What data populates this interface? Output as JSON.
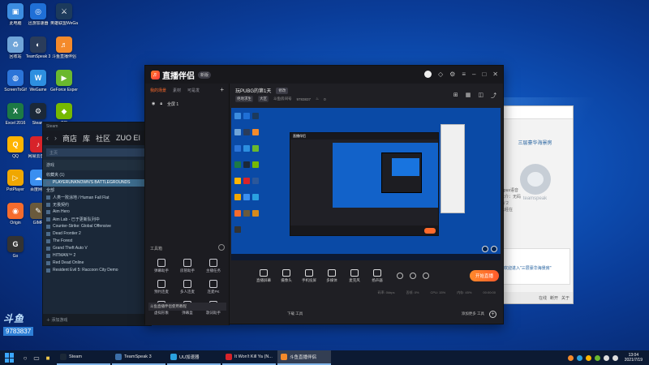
{
  "desktop": {
    "icons": [
      {
        "label": "此电脑",
        "color": "#3c8de0",
        "glyph": "▣"
      },
      {
        "label": "迅游加速器",
        "color": "#1f6fd6",
        "glyph": "◎"
      },
      {
        "label": "英雄联盟WeGame版",
        "color": "#1c3a5c",
        "glyph": "⚔"
      },
      {
        "label": "回收站",
        "color": "#6fa4d8",
        "glyph": "♻"
      },
      {
        "label": "TeamSpeak 3",
        "color": "#2a3c5a",
        "glyph": "◐"
      },
      {
        "label": "斗鱼直播伴侣",
        "color": "#f48a2b",
        "glyph": "♬"
      },
      {
        "label": "ScreenToGif",
        "color": "#2b74d8",
        "glyph": "◍"
      },
      {
        "label": "WeGame",
        "color": "#2d8fe0",
        "glyph": "W"
      },
      {
        "label": "GeForce Experience",
        "color": "#6ab82e",
        "glyph": "▶"
      },
      {
        "label": "Excel 2016",
        "color": "#1d7a45",
        "glyph": "X"
      },
      {
        "label": "Steam",
        "color": "#1b2838",
        "glyph": "⚙"
      },
      {
        "label": "GIF",
        "color": "#76b900",
        "glyph": "◆"
      },
      {
        "label": "QQ",
        "color": "#ffb400",
        "glyph": "Q"
      },
      {
        "label": "网易云音乐",
        "color": "#d8232a",
        "glyph": "♪"
      },
      {
        "label": "Word 2016",
        "color": "#2b579a",
        "glyph": "W"
      },
      {
        "label": "PotPlayer",
        "color": "#f0a700",
        "glyph": "▷"
      },
      {
        "label": "百度网盘",
        "color": "#3b8ff0",
        "glyph": "☁"
      },
      {
        "label": "UU加速器",
        "color": "#2aa1e0",
        "glyph": "U"
      },
      {
        "label": "Origin",
        "color": "#f56c2d",
        "glyph": "◉"
      },
      {
        "label": "GIMP",
        "color": "#6a5a3c",
        "glyph": "✎"
      },
      {
        "label": "Counter-Strike",
        "color": "#d68a1c",
        "glyph": "✦"
      },
      {
        "label": "Go",
        "color": "#333333",
        "glyph": "G"
      }
    ],
    "watermark": {
      "logo": "斗鱼",
      "sub": "直播号",
      "number": "9783837"
    }
  },
  "steam": {
    "title": "Steam",
    "nav": [
      "商店",
      "库",
      "社区",
      "ZUO EI"
    ],
    "search_placeholder": "主页",
    "category": "游戏",
    "fav_header": "收藏夹 (1)",
    "all_header": "全部",
    "games": [
      "PLAYERUNKNOWN'S BATTLEGROUNDS",
      "人类一败涂地 / Human Fall Flat",
      "无畏契约",
      "Aim Hero",
      "Aim Lab - 已于更新队列中",
      "Counter-Strike: Global Offensive",
      "Dead Frontier 2",
      "The Forest",
      "Grand Theft Auto V",
      "HITMAN™ 2",
      "Red Dead Online",
      "Resident Evil 5: Raccoon City Demo"
    ],
    "add_game": "添加游戏"
  },
  "teamspeak": {
    "channel_title": "三层豪华海景房",
    "lines": [
      "Opus语音",
      "未介：无码",
      "1 / 2",
      "已经在"
    ],
    "brand": "teamspeak",
    "chat_msg": "欢迎进入\"三层豪华海景房\"",
    "footer": [
      "在线",
      "断开",
      "关于"
    ]
  },
  "broadcast": {
    "app_name": "直播伴侣",
    "version": "新版",
    "left_tabs": [
      "我的场景",
      "素材",
      "可是发"
    ],
    "scene_label": "全屏 1",
    "tools_header": "工具箱",
    "tools": [
      "弹幕助手",
      "房管助手",
      "主播任务",
      "预约连麦",
      "多人连麦",
      "连麦PK",
      "虚拟形象",
      "弹幕盒",
      "歌词助手"
    ],
    "notice": "斗鱼直播伴侣使用教程",
    "stream_title": "玩PUBG的第1天",
    "modify": "修改",
    "category_chip": "绝地求生",
    "category_tag": "大区",
    "room_label": "斗鱼房间号",
    "room_id": "9783837",
    "fans_count": "0",
    "controls": [
      "直播屏幕",
      "摄像头",
      "手机投屏",
      "多媒体",
      "麦克风",
      "扬声器"
    ],
    "go_live": "开始直播",
    "status": [
      "码率: 0kbps",
      "丢帧: 0%",
      "CPU: 15%",
      "内存: 45%",
      "00:00:00"
    ],
    "footer_left": "下载\n工具",
    "footer_right": "添加更多\n工具"
  },
  "taskbar": {
    "apps": [
      {
        "label": "Steam",
        "color": "#1b2838",
        "active": false
      },
      {
        "label": "TeamSpeak 3",
        "color": "#3b6ea8",
        "active": false
      },
      {
        "label": "UU加速器",
        "color": "#2aa1e0",
        "active": false
      },
      {
        "label": "It Won't Kill Ya (N...",
        "color": "#d8232a",
        "active": false
      },
      {
        "label": "斗鱼直播伴侣",
        "color": "#f48a2b",
        "active": true
      }
    ],
    "time": "13:04",
    "date": "2021/7/19"
  }
}
